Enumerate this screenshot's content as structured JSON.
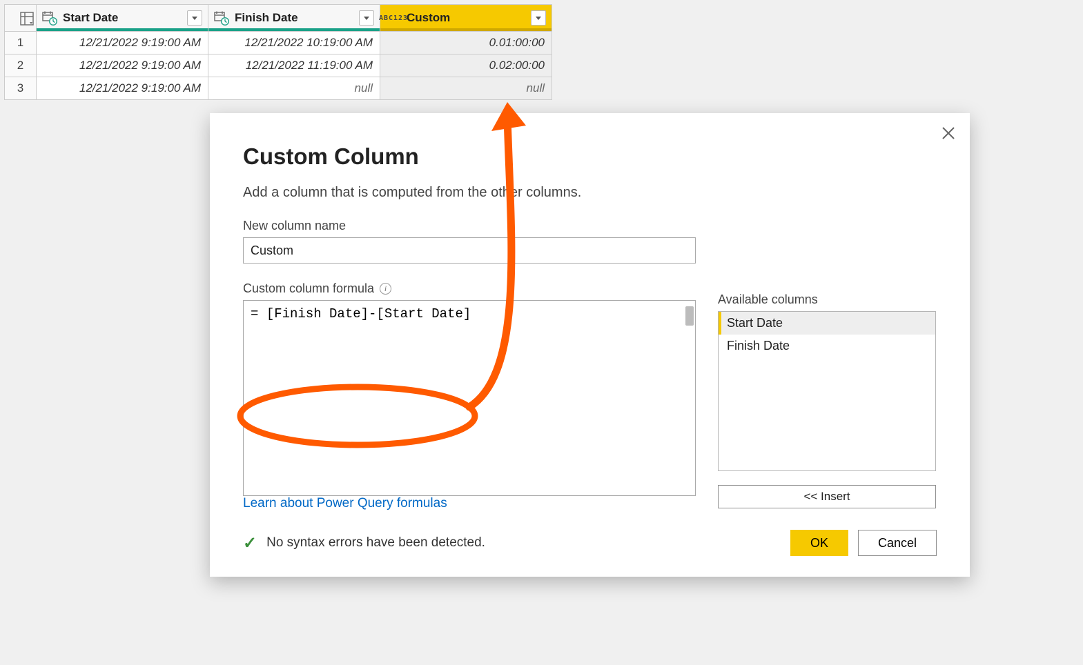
{
  "table": {
    "columns": [
      {
        "name": "Start Date",
        "type": "datetime",
        "selected": false
      },
      {
        "name": "Finish Date",
        "type": "datetime",
        "selected": false
      },
      {
        "name": "Custom",
        "type": "any",
        "selected": true
      }
    ],
    "rows": [
      {
        "n": "1",
        "start": "12/21/2022 9:19:00 AM",
        "finish": "12/21/2022 10:19:00 AM",
        "custom": "0.01:00:00",
        "custom_null": false,
        "finish_null": false
      },
      {
        "n": "2",
        "start": "12/21/2022 9:19:00 AM",
        "finish": "12/21/2022 11:19:00 AM",
        "custom": "0.02:00:00",
        "custom_null": false,
        "finish_null": false
      },
      {
        "n": "3",
        "start": "12/21/2022 9:19:00 AM",
        "finish": "null",
        "custom": "null",
        "custom_null": true,
        "finish_null": true
      }
    ]
  },
  "dialog": {
    "title": "Custom Column",
    "subtitle": "Add a column that is computed from the other columns.",
    "name_label": "New column name",
    "name_value": "Custom",
    "formula_label": "Custom column formula",
    "formula_value": "[Finish Date]-[Start Date]",
    "available_label": "Available columns",
    "available_columns": [
      "Start Date",
      "Finish Date"
    ],
    "available_selected_index": 0,
    "insert_label": "<< Insert",
    "learn_link": "Learn about Power Query formulas",
    "status_text": "No syntax errors have been detected.",
    "ok_label": "OK",
    "cancel_label": "Cancel"
  },
  "type_labels": {
    "any_line1": "ABC",
    "any_line2": "123"
  }
}
